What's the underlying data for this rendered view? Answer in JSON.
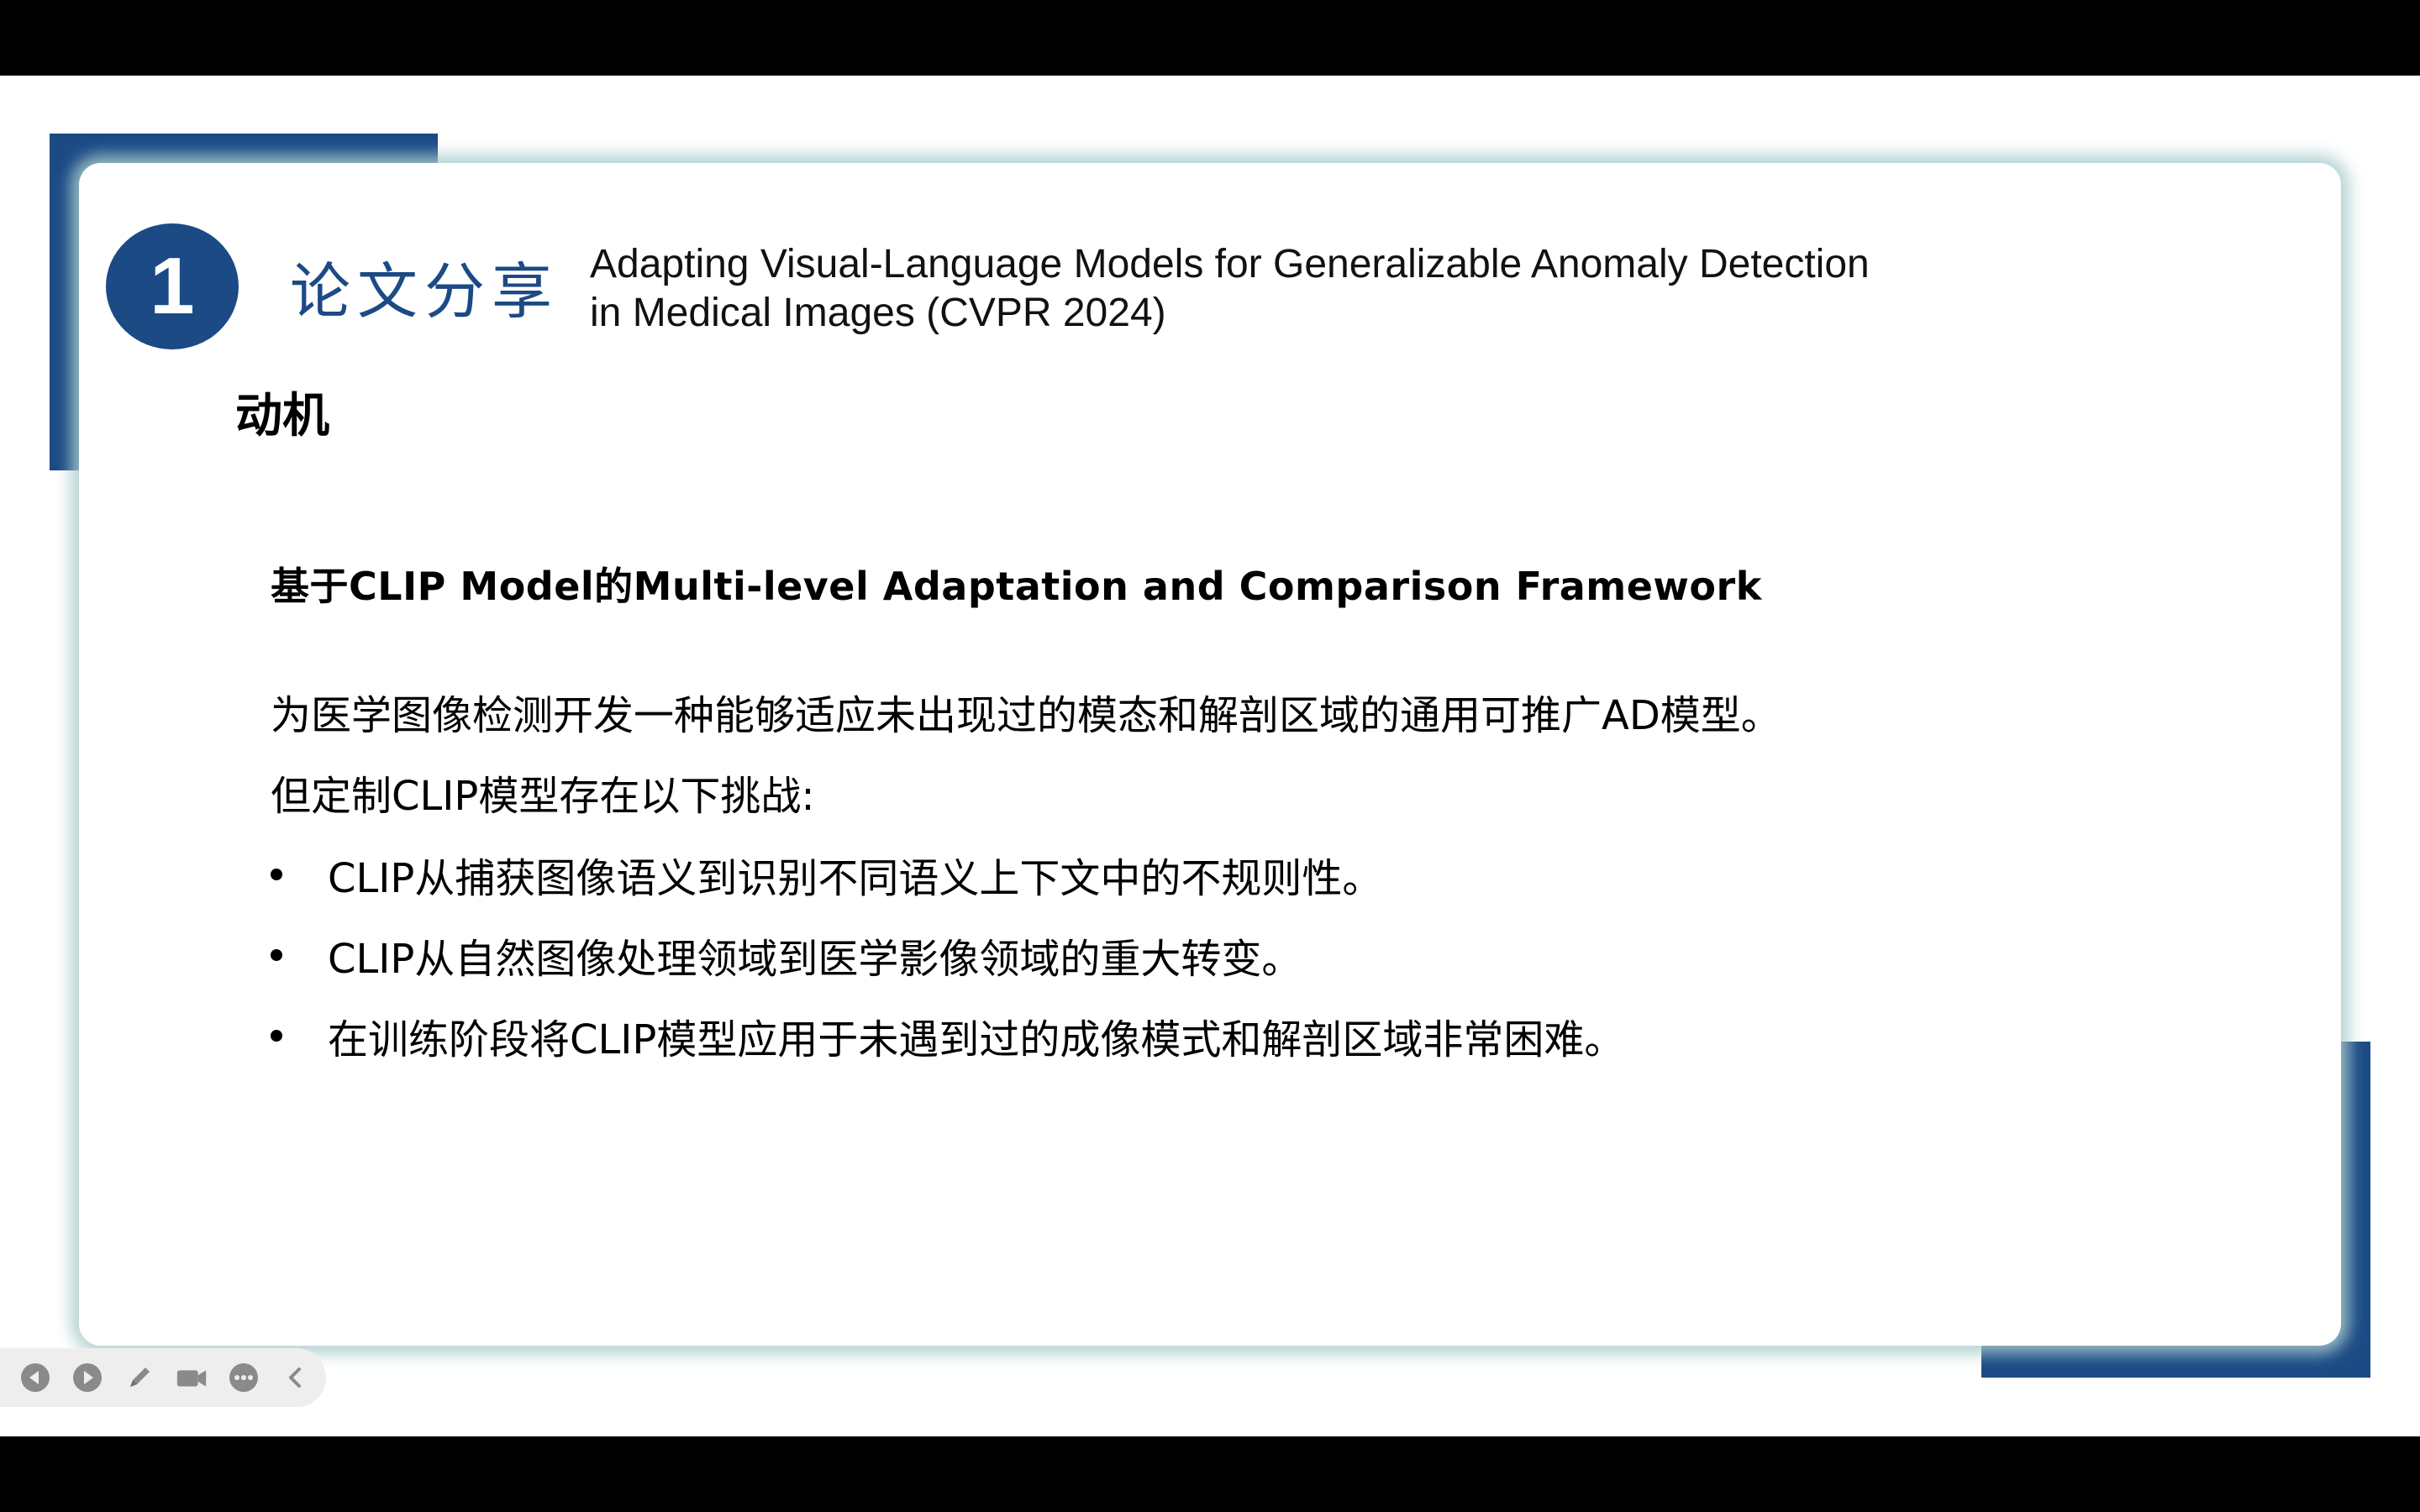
{
  "slide": {
    "number": "1",
    "section_title": "论文分享",
    "paper_title_line1": "Adapting Visual-Language Models for  Generalizable Anomaly Detection",
    "paper_title_line2": "in Medical Images (CVPR 2024)",
    "subtitle": "动机",
    "framework": "基于CLIP Model的Multi-level  Adaptation  and  Comparison  Framework",
    "paragraph1": "为医学图像检测开发一种能够适应未出现过的模态和解剖区域的通用可推广AD模型。",
    "paragraph2": "但定制CLIP模型存在以下挑战:",
    "bullets": [
      "CLIP从捕获图像语义到识别不同语义上下文中的不规则性。",
      "CLIP从自然图像处理领域到医学影像领域的重大转变。",
      "在训练阶段将CLIP模型应用于未遇到过的成像模式和解剖区域非常困难。"
    ]
  },
  "toolbar": {
    "icons": [
      "previous-icon",
      "next-icon",
      "pen-icon",
      "camera-icon",
      "more-icon",
      "collapse-icon"
    ]
  },
  "colors": {
    "accent": "#1b4a85",
    "card_glow": "#aacdcd",
    "letterbox": "#000000"
  }
}
